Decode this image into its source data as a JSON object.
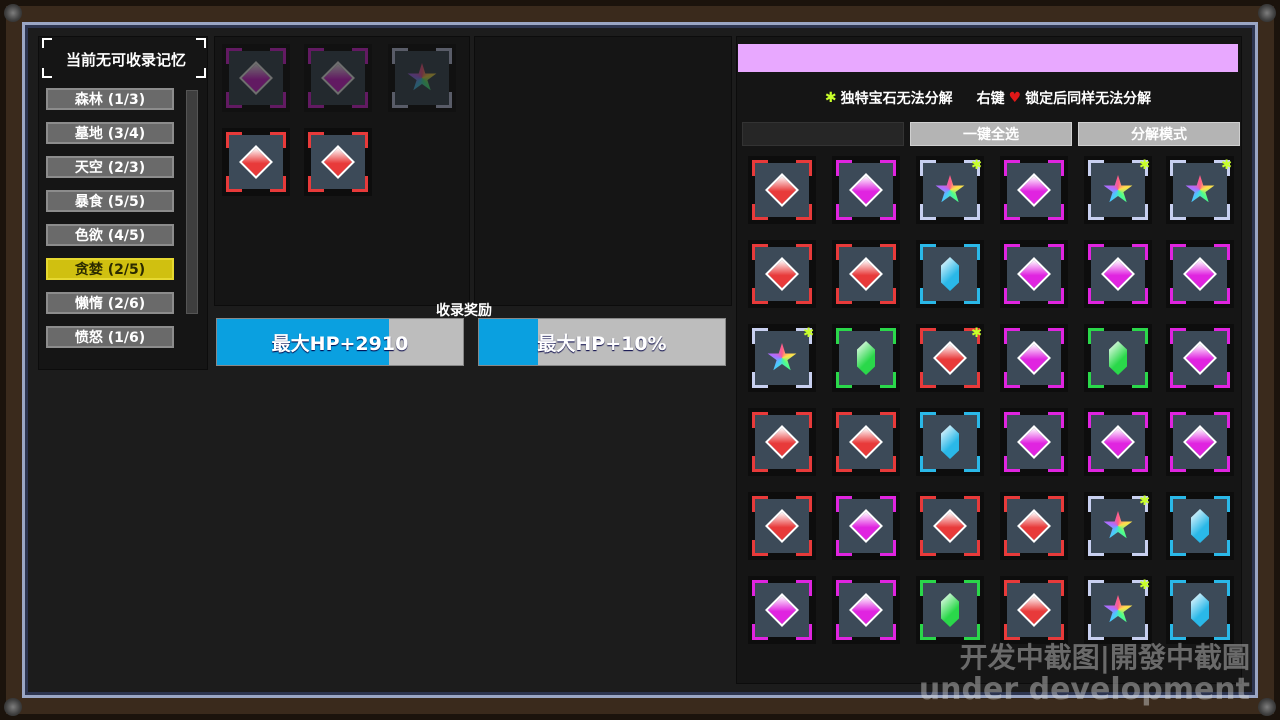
{
  "left_panel": {
    "title": "当前无可收录记忆",
    "categories": [
      {
        "label": "森林 (1/3)",
        "active": false
      },
      {
        "label": "墓地 (3/4)",
        "active": false
      },
      {
        "label": "天空 (2/3)",
        "active": false
      },
      {
        "label": "暴食 (5/5)",
        "active": false
      },
      {
        "label": "色欲 (4/5)",
        "active": false
      },
      {
        "label": "贪婪 (2/5)",
        "active": true
      },
      {
        "label": "懒惰 (2/6)",
        "active": false
      },
      {
        "label": "愤怒 (1/6)",
        "active": false
      }
    ]
  },
  "memory_slots": [
    {
      "gem": "magenta",
      "dim": true
    },
    {
      "gem": "magenta",
      "dim": true
    },
    {
      "gem": "rainbow",
      "dim": true
    },
    {
      "gem": "red",
      "dim": false
    },
    {
      "gem": "red",
      "dim": false
    }
  ],
  "rewards": {
    "label": "收录奖励",
    "items": [
      {
        "text": "最大HP+2910",
        "progress": 0.7
      },
      {
        "text": "最大HP+10%",
        "progress": 0.24
      }
    ]
  },
  "right_panel": {
    "notice_part1": "独特宝石无法分解",
    "notice_part2": "右键",
    "notice_part3": "锁定后同样无法分解",
    "select_all": "一键全选",
    "decompose_mode": "分解模式",
    "grid": [
      [
        "red",
        "magenta",
        "rainbow*",
        "magenta",
        "rainbow*",
        "rainbow*"
      ],
      [
        "red",
        "red",
        "cyan",
        "magenta",
        "magenta",
        "magenta"
      ],
      [
        "rainbow*",
        "green",
        "red*",
        "magenta",
        "green",
        "magenta"
      ],
      [
        "red",
        "red",
        "cyan",
        "magenta",
        "magenta",
        "magenta"
      ],
      [
        "red",
        "magenta",
        "red",
        "red",
        "rainbow*",
        "cyan"
      ],
      [
        "magenta",
        "magenta",
        "green",
        "red",
        "rainbow*",
        "cyan"
      ]
    ]
  },
  "watermark": {
    "line1": "开发中截图|開發中截圖",
    "line2": "under development"
  },
  "colors": {
    "red": "#e83a3a",
    "magenta": "#e024e0",
    "cyan": "#2ab8e8",
    "green": "#2ad84a",
    "rainbow": "#9aa6c4"
  }
}
